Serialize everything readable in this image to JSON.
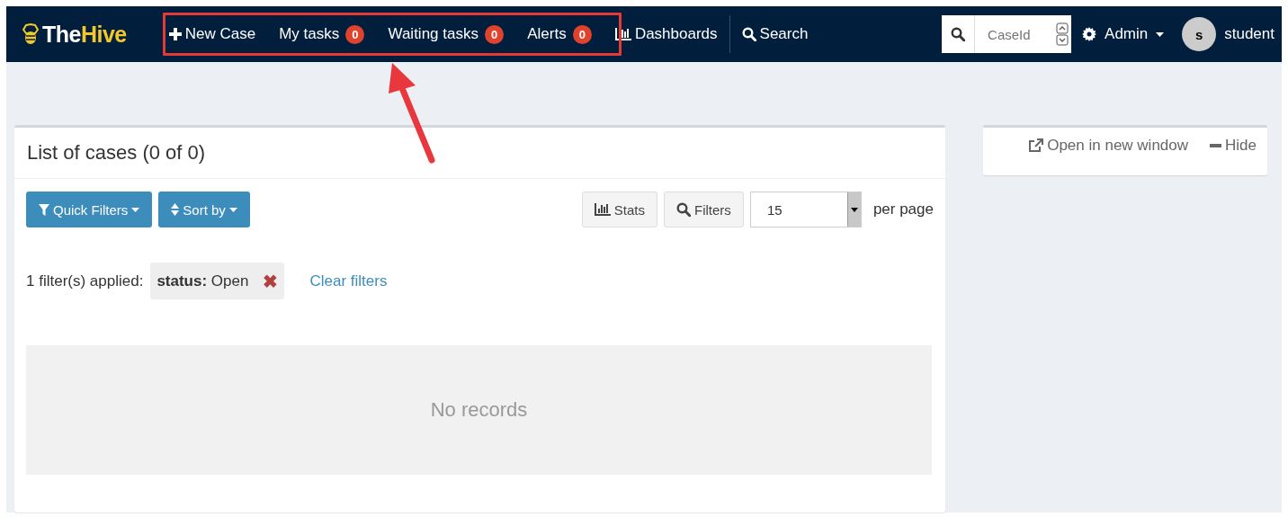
{
  "navbar": {
    "brand_prefix": "The",
    "brand_suffix": "Hive",
    "items": [
      {
        "kind": "add",
        "label": "New Case"
      },
      {
        "kind": "counter",
        "label": "My tasks",
        "count": "0"
      },
      {
        "kind": "counter",
        "label": "Waiting tasks",
        "count": "0"
      },
      {
        "kind": "counter",
        "label": "Alerts",
        "count": "0"
      },
      {
        "kind": "chart",
        "label": "Dashboards"
      },
      {
        "kind": "search",
        "label": "Search"
      }
    ],
    "case_search": {
      "placeholder": "CaseId"
    },
    "admin": "Admin",
    "user": {
      "initial": "s",
      "name": "student"
    }
  },
  "cases": {
    "title": "List of cases (0 of 0)",
    "menus": [
      {
        "kind": "filter",
        "label": "Quick Filters"
      },
      {
        "kind": "sort",
        "label": "Sort by"
      }
    ],
    "tools": [
      {
        "kind": "chart",
        "label": "Stats"
      },
      {
        "kind": "search",
        "label": "Filters"
      }
    ],
    "page_size": "15",
    "page_size_label": "per page",
    "filters_label": "1 filter(s) applied:",
    "filter": {
      "field": "status:",
      "value": "Open",
      "remove": "✖"
    },
    "clear": "Clear filters",
    "empty": "No records"
  },
  "side": {
    "open": "Open in new window",
    "hide": "Hide"
  }
}
